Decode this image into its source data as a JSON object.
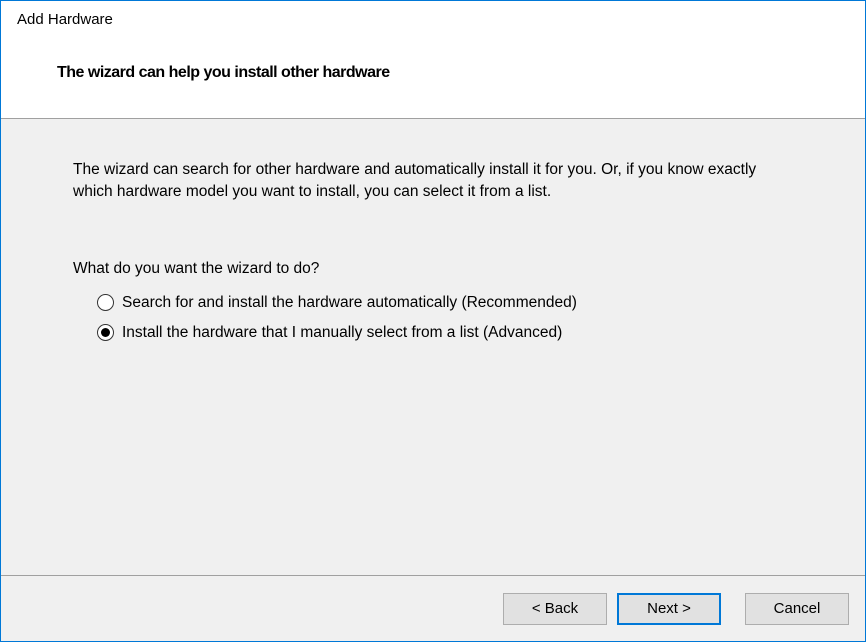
{
  "window": {
    "title": "Add Hardware"
  },
  "wizard": {
    "heading": "The wizard can help you install other hardware",
    "description": "The wizard can search for other hardware and automatically install it for you. Or, if you know exactly which hardware model you want to install, you can select it from a list.",
    "question": "What do you want the wizard to do?",
    "options": {
      "auto": "Search for and install the hardware automatically (Recommended)",
      "manual": "Install the hardware that I manually select from a list (Advanced)"
    },
    "selected": "manual"
  },
  "buttons": {
    "back": "< Back",
    "next": "Next >",
    "cancel": "Cancel"
  }
}
